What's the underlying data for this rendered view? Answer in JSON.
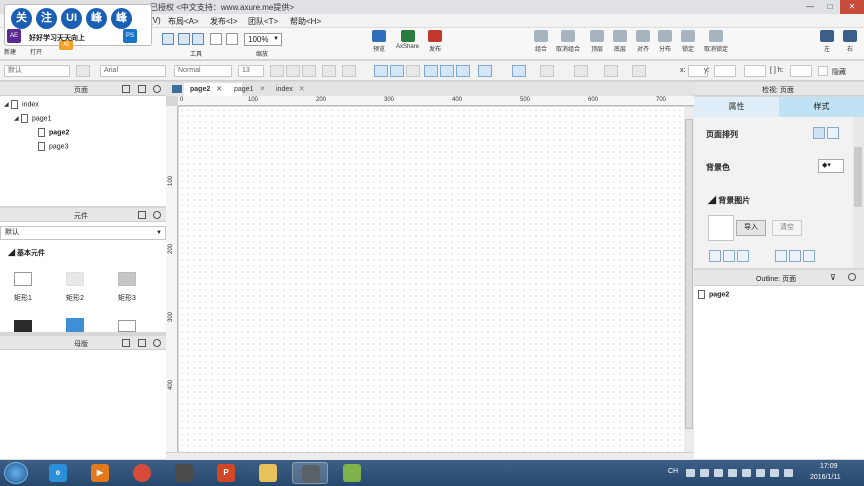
{
  "window": {
    "title_text": "已授权      <中文支持：www.axure.me提供>",
    "min": "—",
    "max": "□",
    "close": "✕"
  },
  "logo": {
    "bubbles": [
      "关",
      "注",
      "UI",
      "峰",
      "峰"
    ],
    "slogan": "好好学习天天向上",
    "ae": "AE",
    "ps": "PS",
    "ai": "AI"
  },
  "menu": {
    "items": [
      "(V)",
      "布局<A>",
      "发布<I>",
      "团队<T>",
      "帮助<H>"
    ]
  },
  "toolbar": {
    "new_label": "新建",
    "open_label": "打开",
    "tools_label": "工具",
    "zoom_value": "100%",
    "zoom_label": "缩放",
    "preview_label": "预览",
    "axshare_label": "AxShare",
    "publish_label": "发布",
    "group_label": "组合",
    "ungroup_label": "取消组合",
    "front_label": "顶层",
    "back_label": "底层",
    "align_label": "对齐",
    "distribute_label": "分布",
    "lock_label": "锁定",
    "unlock_label": "取消锁定",
    "left_label": "左",
    "right_label": "右"
  },
  "formatbar": {
    "style": "默认",
    "font": "Arial",
    "weight": "Normal",
    "size": "13",
    "x_label": "x:",
    "y_label": "y:",
    "w_label": "[ ] h:",
    "hidden_label": "隐藏"
  },
  "pages_panel": {
    "title": "页面",
    "items": [
      {
        "label": "index",
        "expanded": true
      },
      {
        "label": "page1",
        "expanded": true
      },
      {
        "label": "page2",
        "bold": true
      },
      {
        "label": "page3",
        "bold": false
      }
    ]
  },
  "widgets_panel": {
    "title": "元件",
    "library": "默认",
    "section": "基本元件",
    "items": [
      "矩形1",
      "矩形2",
      "矩形3"
    ]
  },
  "masters_panel": {
    "title": "母版"
  },
  "doc_tabs": [
    {
      "label": "page2",
      "active": true
    },
    {
      "label": "page1",
      "active": false
    },
    {
      "label": "index",
      "active": false
    }
  ],
  "ruler": {
    "h_marks": [
      "0",
      "100",
      "200",
      "300",
      "400",
      "500",
      "600",
      "700"
    ],
    "v_marks": [
      "100",
      "200",
      "300",
      "400"
    ]
  },
  "inspector": {
    "title": "检视: 页面",
    "tab_properties": "属性",
    "tab_style": "样式",
    "page_align_label": "页面排列",
    "bg_color_label": "背景色",
    "bg_image_label": "背景图片",
    "import_label": "导入",
    "clear_label": "清空"
  },
  "outline": {
    "title": "Outline: 页面",
    "items": [
      "page2"
    ]
  },
  "taskbar": {
    "lang": "CH",
    "time": "17:09",
    "date": "2016/1/11"
  }
}
